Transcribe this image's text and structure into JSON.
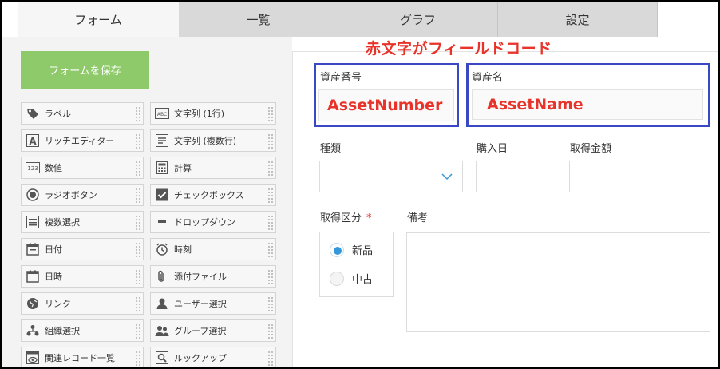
{
  "tabs": [
    {
      "label": "フォーム",
      "active": true
    },
    {
      "label": "一覧",
      "active": false
    },
    {
      "label": "グラフ",
      "active": false
    },
    {
      "label": "設定",
      "active": false
    }
  ],
  "save_button": "フォームを保存",
  "palette": [
    {
      "label": "ラベル",
      "icon": "tag-icon"
    },
    {
      "label": "文字列 (1行)",
      "icon": "abc-icon"
    },
    {
      "label": "リッチエディター",
      "icon": "rich-text-icon"
    },
    {
      "label": "文字列 (複数行)",
      "icon": "multiline-text-icon"
    },
    {
      "label": "数値",
      "icon": "number-icon"
    },
    {
      "label": "計算",
      "icon": "calculator-icon"
    },
    {
      "label": "ラジオボタン",
      "icon": "radio-icon"
    },
    {
      "label": "チェックボックス",
      "icon": "checkbox-icon"
    },
    {
      "label": "複数選択",
      "icon": "multi-select-icon"
    },
    {
      "label": "ドロップダウン",
      "icon": "dropdown-icon"
    },
    {
      "label": "日付",
      "icon": "calendar-date-icon"
    },
    {
      "label": "時刻",
      "icon": "clock-icon"
    },
    {
      "label": "日時",
      "icon": "calendar-datetime-icon"
    },
    {
      "label": "添付ファイル",
      "icon": "paperclip-icon"
    },
    {
      "label": "リンク",
      "icon": "globe-icon"
    },
    {
      "label": "ユーザー選択",
      "icon": "user-icon"
    },
    {
      "label": "組織選択",
      "icon": "org-icon"
    },
    {
      "label": "グループ選択",
      "icon": "group-icon"
    },
    {
      "label": "関連レコード一覧",
      "icon": "related-records-icon"
    },
    {
      "label": "ルックアップ",
      "icon": "lookup-icon"
    }
  ],
  "annotation": "赤文字がフィールドコード",
  "fields": {
    "asset_number_label": "資産番号",
    "asset_number_code": "AssetNumber",
    "asset_name_label": "資産名",
    "asset_name_code": "AssetName",
    "kind_label": "種類",
    "kind_value": "-----",
    "purchase_date_label": "購入日",
    "acquisition_cost_label": "取得金額",
    "acquisition_type_label": "取得区分",
    "required_mark": "*",
    "radio_options": [
      {
        "label": "新品",
        "selected": true
      },
      {
        "label": "中古",
        "selected": false
      }
    ],
    "remarks_label": "備考"
  },
  "colors": {
    "accent_blue": "#3b48c6",
    "annotation_red": "#e8332a",
    "save_green": "#8ec96a",
    "radio_blue": "#3498db"
  }
}
